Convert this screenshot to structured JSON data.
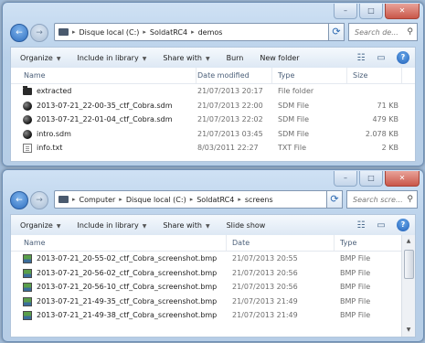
{
  "windows": [
    {
      "id": "demos",
      "caption_buttons": {
        "minimize": "–",
        "maximize": "□",
        "close": "✕"
      },
      "nav": {
        "back_glyph": "←",
        "forward_glyph": "→"
      },
      "address": {
        "crumbs": [
          "Disque local (C:)",
          "SoldatRC4",
          "demos"
        ],
        "separator": "▸",
        "dropdown_glyph": "▼"
      },
      "refresh_glyph": "⟳",
      "search": {
        "placeholder": "Search de...",
        "icon_glyph": "⚲"
      },
      "toolbar": {
        "items": [
          "Organize",
          "Include in library",
          "Share with",
          "Burn",
          "New folder"
        ],
        "has_arrow": [
          true,
          true,
          true,
          false,
          false
        ],
        "arrow_glyph": "▼",
        "view_glyph": "☷",
        "pane_glyph": "▭",
        "help_glyph": "?"
      },
      "columns": [
        "Name",
        "Date modified",
        "Type",
        "Size"
      ],
      "rows": [
        {
          "icon": "folder",
          "name": "extracted",
          "date": "21/07/2013 20:17",
          "type": "File folder",
          "size": ""
        },
        {
          "icon": "sdm",
          "name": "2013-07-21_22-00-35_ctf_Cobra.sdm",
          "date": "21/07/2013 22:00",
          "type": "SDM File",
          "size": "71 KB"
        },
        {
          "icon": "sdm",
          "name": "2013-07-21_22-01-04_ctf_Cobra.sdm",
          "date": "21/07/2013 22:02",
          "type": "SDM File",
          "size": "479 KB"
        },
        {
          "icon": "sdm",
          "name": "intro.sdm",
          "date": "21/07/2013 03:45",
          "type": "SDM File",
          "size": "2.078 KB"
        },
        {
          "icon": "txt",
          "name": "info.txt",
          "date": "8/03/2011 22:27",
          "type": "TXT File",
          "size": "2 KB"
        }
      ]
    },
    {
      "id": "screens",
      "caption_buttons": {
        "minimize": "–",
        "maximize": "□",
        "close": "✕"
      },
      "nav": {
        "back_glyph": "←",
        "forward_glyph": "→"
      },
      "address": {
        "crumbs": [
          "Computer",
          "Disque local (C:)",
          "SoldatRC4",
          "screens"
        ],
        "separator": "▸",
        "dropdown_glyph": "▼"
      },
      "refresh_glyph": "⟳",
      "search": {
        "placeholder": "Search scre...",
        "icon_glyph": "⚲"
      },
      "toolbar": {
        "items": [
          "Organize",
          "Include in library",
          "Share with",
          "Slide show"
        ],
        "has_arrow": [
          true,
          true,
          true,
          false
        ],
        "arrow_glyph": "▼",
        "view_glyph": "☷",
        "pane_glyph": "▭",
        "help_glyph": "?"
      },
      "columns": [
        "Name",
        "Date",
        "Type"
      ],
      "rows": [
        {
          "icon": "bmp",
          "name": "2013-07-21_20-55-02_ctf_Cobra_screenshot.bmp",
          "date": "21/07/2013 20:55",
          "type": "BMP File"
        },
        {
          "icon": "bmp",
          "name": "2013-07-21_20-56-02_ctf_Cobra_screenshot.bmp",
          "date": "21/07/2013 20:56",
          "type": "BMP File"
        },
        {
          "icon": "bmp",
          "name": "2013-07-21_20-56-10_ctf_Cobra_screenshot.bmp",
          "date": "21/07/2013 20:56",
          "type": "BMP File"
        },
        {
          "icon": "bmp",
          "name": "2013-07-21_21-49-35_ctf_Cobra_screenshot.bmp",
          "date": "21/07/2013 21:49",
          "type": "BMP File"
        },
        {
          "icon": "bmp",
          "name": "2013-07-21_21-49-38_ctf_Cobra_screenshot.bmp",
          "date": "21/07/2013 21:49",
          "type": "BMP File"
        }
      ],
      "scrollbar": {
        "up_glyph": "▲",
        "down_glyph": "▼"
      }
    }
  ]
}
